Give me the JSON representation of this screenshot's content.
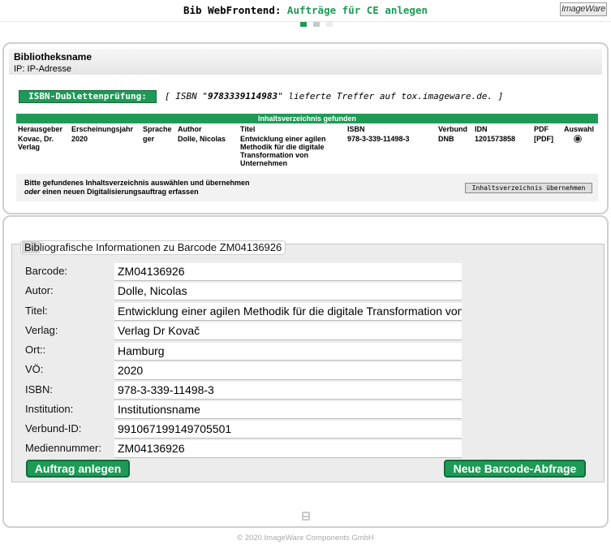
{
  "header": {
    "app_name": "Bib WebFrontend",
    "separator": ":",
    "page_title": "Aufträge für CE anlegen",
    "logo_text": "ImageWare"
  },
  "library_panel": {
    "library_name": "Bibliotheksname",
    "ip_label": "IP",
    "ip_value": "IP-Adresse"
  },
  "isbn_check": {
    "button_label": "ISBN-Dublettenprüfung:",
    "result_prefix": "[ ISBN \"",
    "isbn": "9783339114983",
    "result_suffix": "\" lieferte Treffer auf tox.imageware.de. ]"
  },
  "toc": {
    "title": "Inhaltsverzeichnis gefunden",
    "columns": [
      "Herausgeber",
      "Erscheinungsjahr",
      "Sprache",
      "Author",
      "Titel",
      "ISBN",
      "Verbund",
      "IDN",
      "PDF",
      "Auswahl"
    ],
    "rows": [
      [
        "Kovac, Dr. Verlag",
        "2020",
        "ger",
        "Dolle, Nicolas",
        "Entwicklung einer agilen Methodik für die digitale Transformation von Unternehmen",
        "978-3-339-11498-3",
        "DNB",
        "1201573858",
        "[PDF]",
        ""
      ]
    ],
    "selected": true,
    "instruction_line1": "Bitte gefundenes Inhaltsverzeichnis auswählen und übernehmen",
    "instruction_oder": "oder",
    "instruction_line2": " einen neuen Digitalisierungsauftrag erfassen",
    "apply_button": "Inhaltsverzeichnis übernehmen"
  },
  "biblio": {
    "legend_hl": "Bib",
    "legend_rest": "liografische Informationen zu Barcode ZM04136926",
    "fields": [
      {
        "label": "Barcode:",
        "value": "ZM04136926"
      },
      {
        "label": "Autor:",
        "value": "Dolle, Nicolas"
      },
      {
        "label": "Titel:",
        "value": "Entwicklung einer agilen Methodik für die digitale Transformation von Unternehmen"
      },
      {
        "label": "Verlag:",
        "value": "Verlag Dr Kovač"
      },
      {
        "label": "Ort::",
        "value": "Hamburg"
      },
      {
        "label": "VÖ:",
        "value": "2020"
      },
      {
        "label": "ISBN:",
        "value": "978-3-339-11498-3"
      },
      {
        "label": "Institution:",
        "value": "Institutionsname"
      },
      {
        "label": "Verbund-ID:",
        "value": "991067199149705501"
      },
      {
        "label": "Mediennummer:",
        "value": "ZM04136926"
      }
    ],
    "create_button": "Auftrag anlegen",
    "new_barcode_button": "Neue Barcode-Abfrage"
  },
  "footer": {
    "copyright": "©  2020 ImageWare Components GmbH"
  },
  "colors": {
    "accent": "#1e9a56",
    "accent_dark": "#0f6b3a"
  }
}
